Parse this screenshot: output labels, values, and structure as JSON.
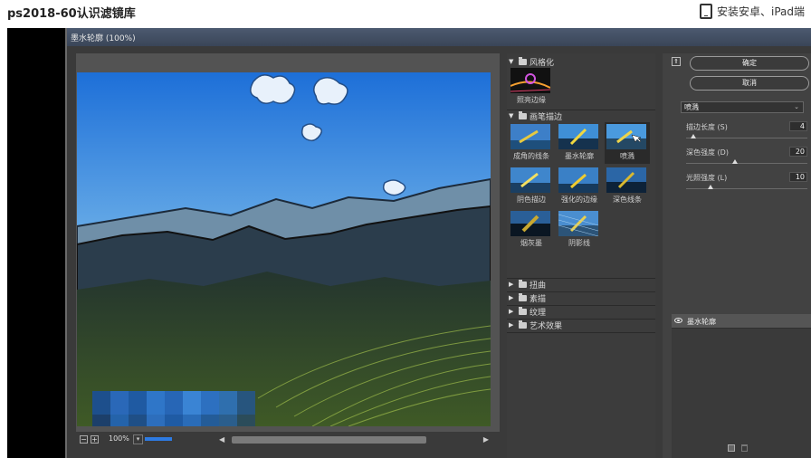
{
  "page": {
    "title": "ps2018-60认识滤镜库",
    "device_link": "安装安卓、iPad端"
  },
  "dialog": {
    "title": "墨水轮廓 (100%)",
    "zoom": "100%"
  },
  "gallery": {
    "categories": [
      {
        "name": "风格化",
        "expanded": true,
        "filters": [
          "照亮边缘"
        ]
      },
      {
        "name": "画笔描边",
        "expanded": true,
        "filters": [
          "成角的线条",
          "墨水轮廓",
          "喷溅",
          "强化的边缘",
          "深色线条",
          "烟灰墨",
          "阴影线"
        ],
        "selected": "喷溅"
      },
      {
        "name": "扭曲",
        "expanded": false
      },
      {
        "name": "素描",
        "expanded": false
      },
      {
        "name": "纹理",
        "expanded": false
      },
      {
        "name": "艺术效果",
        "expanded": false
      }
    ],
    "brush_labels": {
      "f1": "成角的线条",
      "f2": "墨水轮廓",
      "f3": "喷溅",
      "f4": "阴色描边",
      "f5": "强化的边缘",
      "f6": "深色线条",
      "f7": "烟灰墨",
      "f8": "阴影线"
    },
    "stylize_label": "照亮边缘"
  },
  "settings": {
    "ok_label": "确定",
    "cancel_label": "取消",
    "selected_filter": "喷溅",
    "params": [
      {
        "label": "描边长度 (S)",
        "value": "4",
        "fraction": 0.06
      },
      {
        "label": "深色强度 (D)",
        "value": "20",
        "fraction": 0.4
      },
      {
        "label": "光照强度 (L)",
        "value": "10",
        "fraction": 0.2
      }
    ],
    "layer_name": "墨水轮廓"
  },
  "colors": {
    "accent": "#2d7be3",
    "dialog_bg": "#3a3a3a"
  }
}
